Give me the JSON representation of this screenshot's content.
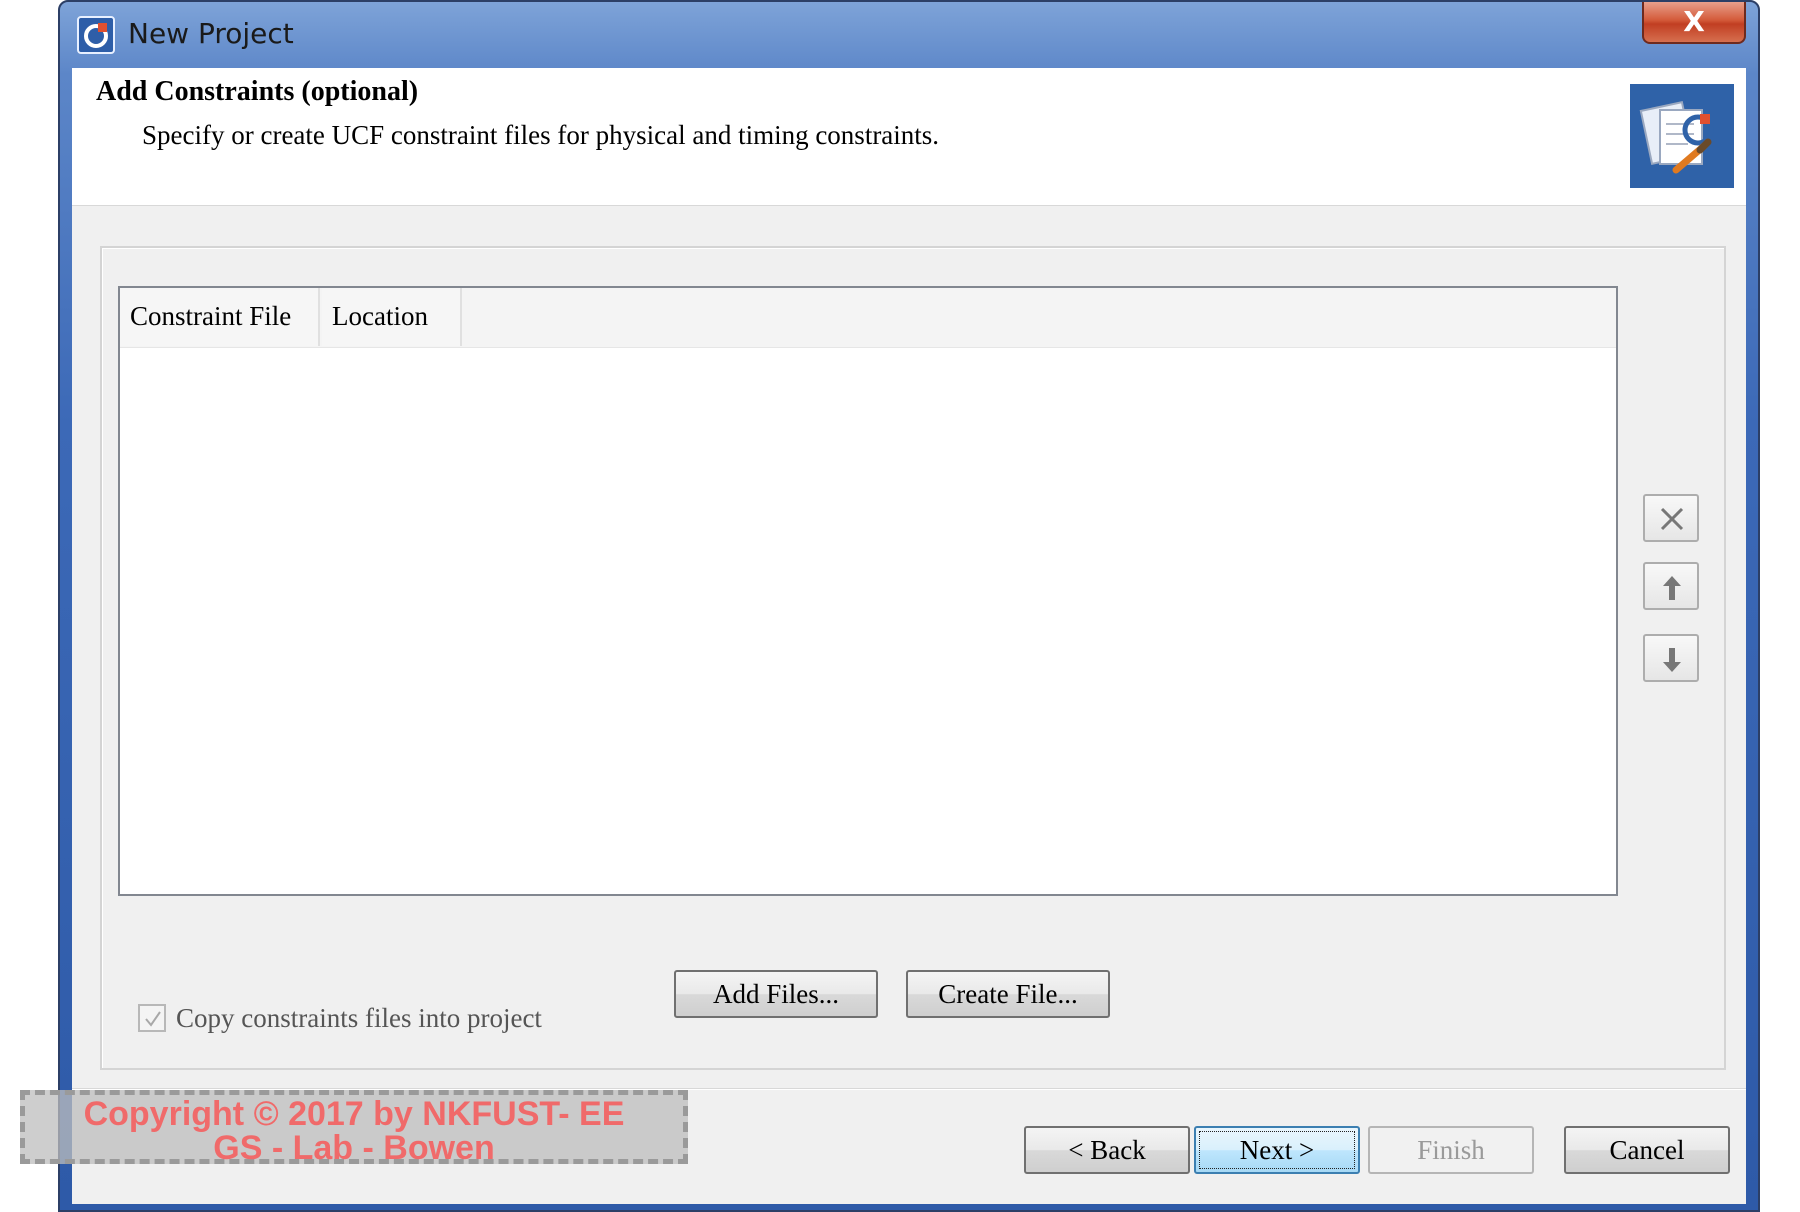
{
  "window": {
    "title": "New Project",
    "close_label": "X",
    "app_icon": "ise-project-icon"
  },
  "header": {
    "title": "Add Constraints (optional)",
    "description": "Specify or create UCF constraint files for physical and timing constraints.",
    "image_icon": "constraints-wizard-icon"
  },
  "table": {
    "columns": [
      "Constraint File",
      "Location"
    ],
    "rows": []
  },
  "side_buttons": {
    "remove_icon": "remove-x-icon",
    "move_up_icon": "arrow-up-icon",
    "move_down_icon": "arrow-down-icon"
  },
  "actions": {
    "add_files": "Add Files...",
    "create_file": "Create File..."
  },
  "copy_option": {
    "label": "Copy constraints files into project",
    "checked": true,
    "enabled": false
  },
  "footer": {
    "back": "< Back",
    "next": "Next >",
    "finish": "Finish",
    "cancel": "Cancel"
  },
  "watermark": {
    "line1": "Copyright © 2017 by NKFUST- EE",
    "line2": "GS - Lab - Bowen"
  },
  "colors": {
    "frame": "#3c69b7",
    "close": "#c13e22",
    "default_button": "#a7d9f5",
    "watermark_text": "#f06a6a"
  }
}
